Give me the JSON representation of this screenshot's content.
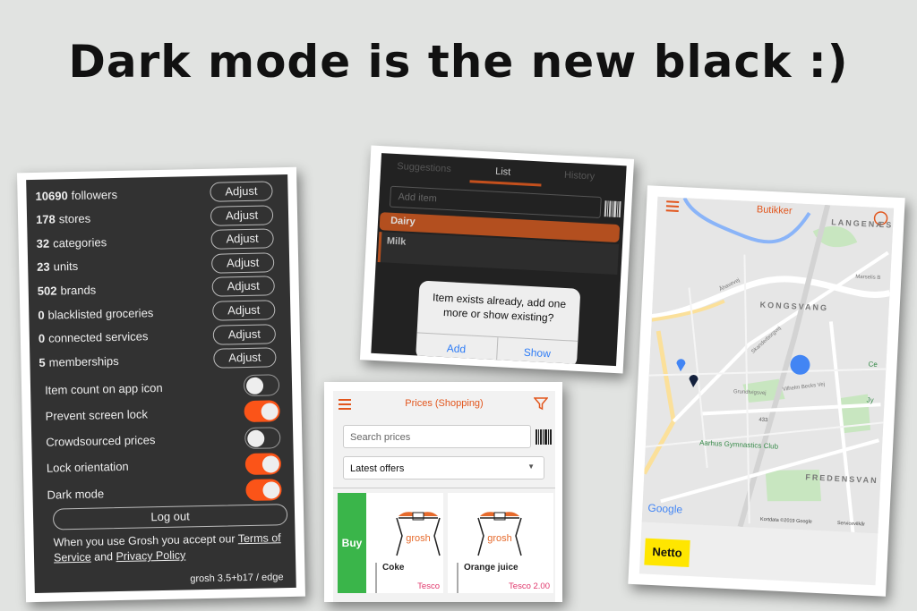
{
  "headline": "Dark mode is the new black :)",
  "settings_screen": {
    "stats": [
      {
        "count": "10690",
        "label": "followers",
        "button": "Adjust"
      },
      {
        "count": "178",
        "label": "stores",
        "button": "Adjust"
      },
      {
        "count": "32",
        "label": "categories",
        "button": "Adjust"
      },
      {
        "count": "23",
        "label": "units",
        "button": "Adjust"
      },
      {
        "count": "502",
        "label": "brands",
        "button": "Adjust"
      },
      {
        "count": "0",
        "label": "blacklisted groceries",
        "button": "Adjust"
      },
      {
        "count": "0",
        "label": "connected services",
        "button": "Adjust"
      },
      {
        "count": "5",
        "label": "memberships",
        "button": "Adjust"
      }
    ],
    "toggles": [
      {
        "label": "Item count on app icon",
        "on": false
      },
      {
        "label": "Prevent screen lock",
        "on": true
      },
      {
        "label": "Crowdsourced prices",
        "on": false
      },
      {
        "label": "Lock orientation",
        "on": true
      },
      {
        "label": "Dark mode",
        "on": true
      }
    ],
    "logout": "Log out",
    "terms_prefix": "When you use Grosh you accept our ",
    "terms_link": "Terms of Service",
    "terms_and": " and ",
    "privacy_link": "Privacy Policy",
    "version": "grosh 3.5+b17 / edge",
    "toggle_on_color": "#fb5418"
  },
  "list_screen": {
    "tabs": [
      "Suggestions",
      "List",
      "History"
    ],
    "active_tab": "List",
    "add_placeholder": "Add item",
    "category": "Dairy",
    "item": "Milk",
    "dialog": {
      "message": "Item exists already, add one more or show existing?",
      "add": "Add",
      "show": "Show"
    }
  },
  "prices_screen": {
    "title": "Prices (Shopping)",
    "search_placeholder": "Search prices",
    "sort_selected": "Latest offers",
    "buy": "Buy",
    "logo_text": "grosh",
    "products": [
      {
        "name": "Coke",
        "price": "Tesco"
      },
      {
        "name": "Orange juice",
        "price": "Tesco 2.00"
      }
    ]
  },
  "map_screen": {
    "title": "Butikker",
    "labels": {
      "langenaes": "LANGENÆS",
      "kongsvang": "KONGSVANG",
      "fredensvang": "FREDENSVAN",
      "club": "Aarhus Gymnastics Club",
      "aahavevej": "Åhavevej",
      "skanderborgvej": "Skanderborgvej",
      "grundtvigsvej": "Grundtvigsvej",
      "vilhelm": "Vilhelm Becks Vej",
      "marselis": "Marselis B",
      "route": "433",
      "ce": "Ce",
      "jy": "Jy"
    },
    "google": "Google",
    "attribution": "Kortdata ©2019 Google",
    "terms": "Servicevilkår",
    "store": "Netto"
  }
}
